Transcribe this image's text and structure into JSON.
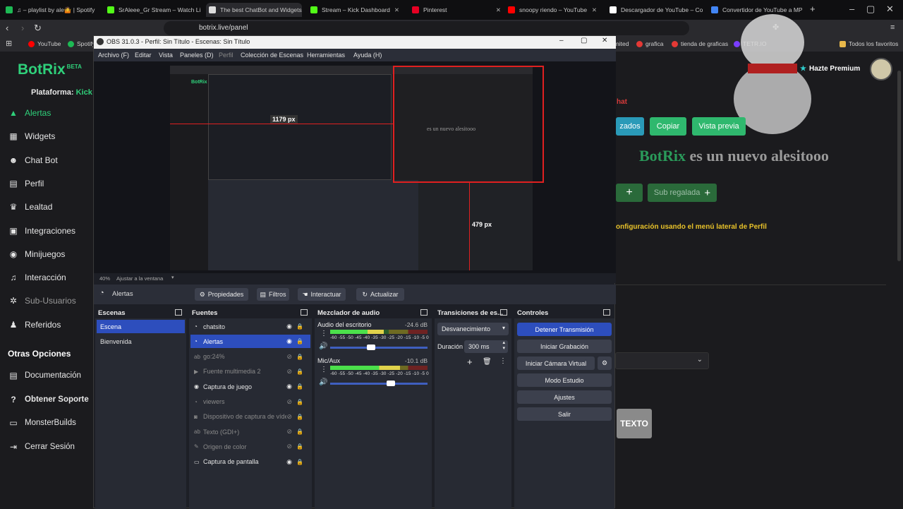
{
  "browser": {
    "tabs": [
      {
        "label": "♫ – playlist by ale🤷 | Spotify",
        "color": "#1db954"
      },
      {
        "label": "SrAleee_Gr Stream – Watch Live",
        "color": "#53fc18"
      },
      {
        "label": "The best ChatBot and Widgets",
        "color": "#dddddd"
      },
      {
        "label": "Stream – Kick Dashboard",
        "color": "#53fc18"
      },
      {
        "label": "Pinterest",
        "color": "#e60023"
      },
      {
        "label": "snoopy riendo – YouTube",
        "color": "#ff0000"
      },
      {
        "label": "Descargador de YouTube – Con",
        "color": "#ffffff"
      },
      {
        "label": "Convertidor de YouTube a MP",
        "color": "#4285f4"
      }
    ],
    "url": "botrix.live/panel",
    "bookmarks": [
      {
        "label": "YouTube",
        "color": "#ff0000"
      },
      {
        "label": "Spotify",
        "color": "#1db954"
      },
      {
        "label": "nited",
        "color": "#888888"
      },
      {
        "label": "grafica",
        "color": "#e53935"
      },
      {
        "label": "tienda de graficas",
        "color": "#e53935"
      },
      {
        "label": "TETR.IO",
        "color": "#7a3dff"
      }
    ],
    "all_bookmarks": "Todos los favoritos"
  },
  "botrix": {
    "logo": "BotRix",
    "beta": "BETA",
    "platform_label": "Plataforma:",
    "platform": "Kick",
    "nav": [
      {
        "label": "Alertas",
        "icon": "alert-icon",
        "glyph": "▲"
      },
      {
        "label": "Widgets",
        "icon": "widgets-icon",
        "glyph": "▦"
      },
      {
        "label": "Chat Bot",
        "icon": "robot-icon",
        "glyph": "☻"
      },
      {
        "label": "Perfil",
        "icon": "profile-icon",
        "glyph": "▤"
      },
      {
        "label": "Lealtad",
        "icon": "trophy-icon",
        "glyph": "♛"
      },
      {
        "label": "Integraciones",
        "icon": "integrations-icon",
        "glyph": "▣"
      },
      {
        "label": "Minijuegos",
        "icon": "gamepad-icon",
        "glyph": "◉"
      },
      {
        "label": "Interacción",
        "icon": "music-icon",
        "glyph": "♫"
      },
      {
        "label": "Sub-Usuarios",
        "icon": "gear-icon",
        "glyph": "✲"
      },
      {
        "label": "Referidos",
        "icon": "users-icon",
        "glyph": "♟"
      }
    ],
    "other_options": "Otras Opciones",
    "other_nav": [
      {
        "label": "Documentación",
        "icon": "docs-icon",
        "glyph": "▤"
      },
      {
        "label": "Obtener Soporte",
        "icon": "help-icon",
        "glyph": "?"
      },
      {
        "label": "MonsterBuilds",
        "icon": "laptop-icon",
        "glyph": "▭"
      },
      {
        "label": "Cerrar Sesión",
        "icon": "logout-icon",
        "glyph": "⇥"
      }
    ],
    "premium": "Hazte Premium",
    "chat_fragment": "hat",
    "btn_avanzados": "zados",
    "btn_copiar": "Copiar",
    "btn_vista_previa": "Vista previa",
    "headline_brand": "BotRix",
    "headline_rest": "es un nuevo alesitooo",
    "sub_regalada": "Sub regalada",
    "config_hint": "onfiguración usando el menú lateral de Perfil",
    "texto_btn": "TEXTO"
  },
  "obs": {
    "title": "OBS 31.0.3 - Perfil: Sin Título - Escenas: Sin Título",
    "menu": [
      "Archivo (F)",
      "Editar",
      "Vista",
      "Paneles (D)",
      "Perfil",
      "Colección de Escenas",
      "Herramientas",
      "Ayuda (H)"
    ],
    "zoom": "40%",
    "fit": "Ajustar a la ventana",
    "preview_size_label_1": "1179 px",
    "preview_size_label_2": "479 px",
    "selected_source": "Alertas",
    "source_buttons": [
      "Propiedades",
      "Filtros",
      "Interactuar",
      "Actualizar"
    ],
    "docks": {
      "scenes": "Escenas",
      "sources": "Fuentes",
      "mixer": "Mezclador de audio",
      "transitions": "Transiciones de es...",
      "controls": "Controles"
    },
    "scenes": [
      "Escena",
      "Bienvenida"
    ],
    "sources": [
      {
        "label": "chatsito",
        "icon": "browser-source-icon",
        "glyph": "◔",
        "visible": true
      },
      {
        "label": "Alertas",
        "icon": "browser-source-icon",
        "glyph": "◔",
        "visible": true
      },
      {
        "label": "go:24%",
        "icon": "text-source-icon",
        "glyph": "ab",
        "visible": false
      },
      {
        "label": "Fuente multimedia 2",
        "icon": "media-source-icon",
        "glyph": "▶",
        "visible": false
      },
      {
        "label": "Captura de juego",
        "icon": "game-capture-icon",
        "glyph": "◉",
        "visible": true
      },
      {
        "label": "viewers",
        "icon": "browser-source-icon",
        "glyph": "◔",
        "visible": false
      },
      {
        "label": "Dispositivo de captura de vídeo",
        "icon": "camera-icon",
        "glyph": "◙",
        "visible": false
      },
      {
        "label": "Texto (GDI+)",
        "icon": "text-source-icon",
        "glyph": "ab",
        "visible": false
      },
      {
        "label": "Origen de color",
        "icon": "brush-icon",
        "glyph": "✎",
        "visible": false
      },
      {
        "label": "Captura de pantalla",
        "icon": "monitor-icon",
        "glyph": "▭",
        "visible": true
      }
    ],
    "mixer": [
      {
        "name": "Audio del escritorio",
        "db": "-24.6 dB",
        "level": 0.55,
        "volume": 0.42
      },
      {
        "name": "Mic/Aux",
        "db": "-10.1 dB",
        "level": 0.72,
        "volume": 0.62
      }
    ],
    "meter_scale": "-60 -55 -50 -45 -40 -35 -30 -25 -20 -15 -10 -5 0",
    "transition": "Desvanecimiento",
    "duration_label": "Duración",
    "duration": "300 ms",
    "controls": [
      "Detener Transmisión",
      "Iniciar Grabación",
      "Iniciar Cámara Virtual",
      "Modo Estudio",
      "Ajustes",
      "Salir"
    ]
  }
}
